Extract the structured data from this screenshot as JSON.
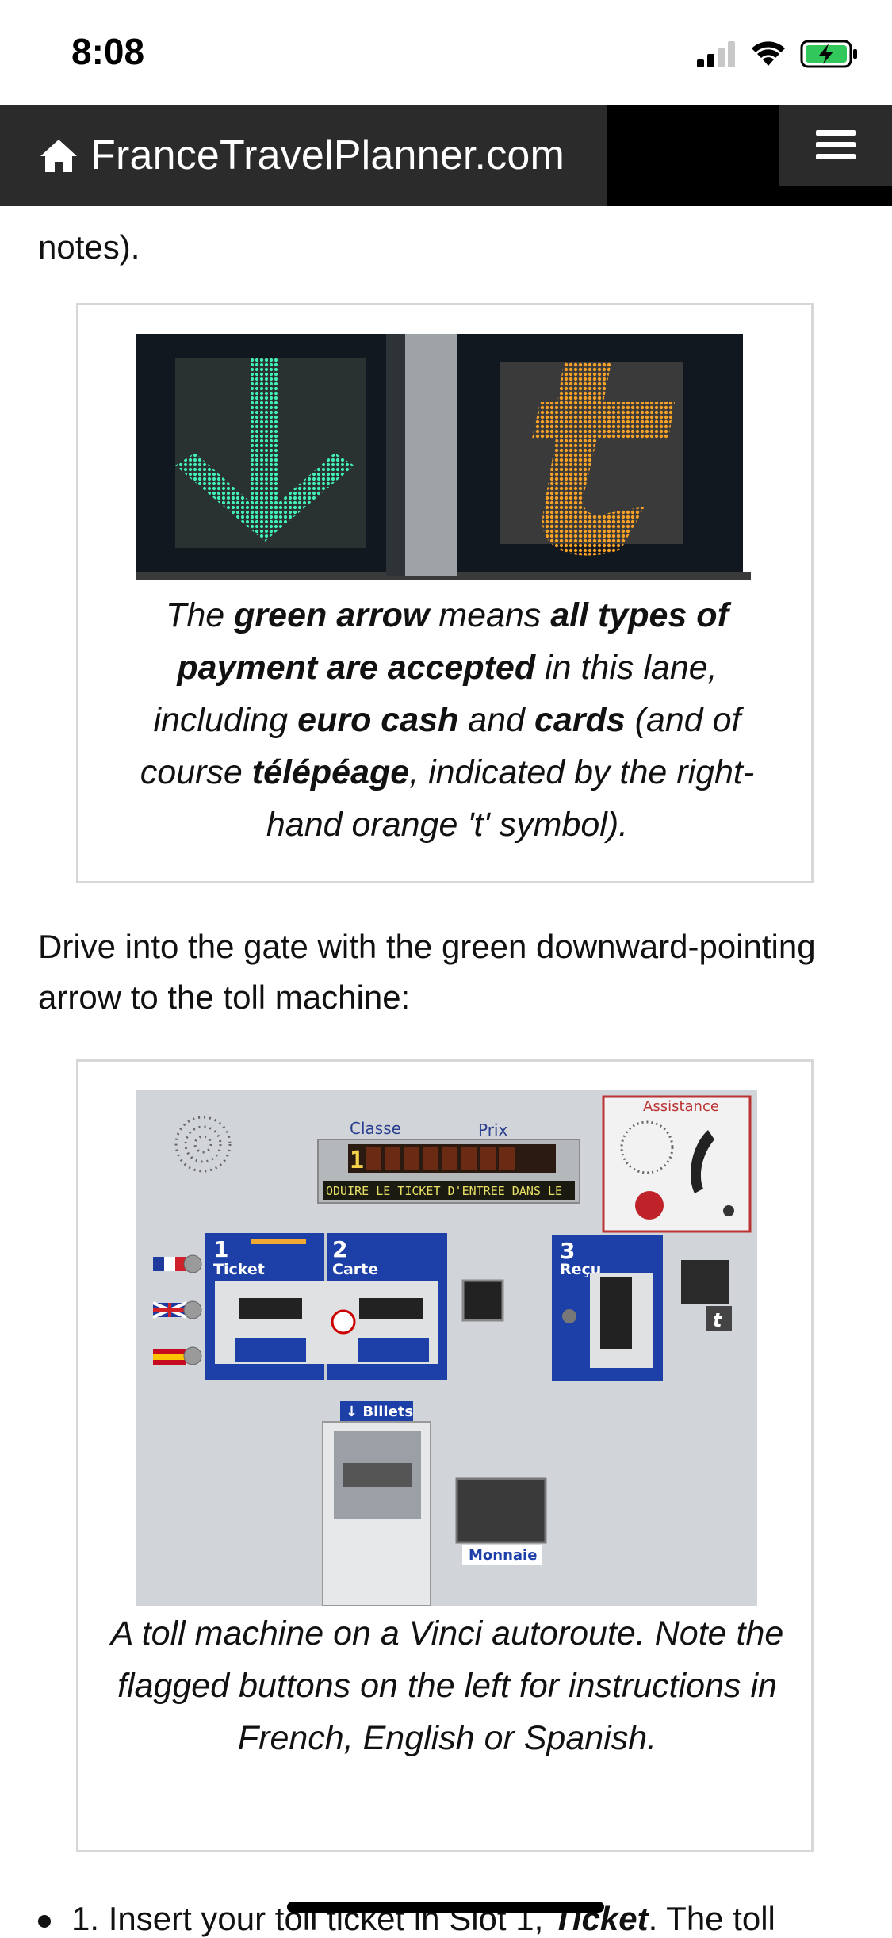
{
  "status_bar": {
    "time": "8:08"
  },
  "header": {
    "site_name": "FranceTravelPlanner.com"
  },
  "article": {
    "partial_line": "notes).",
    "figure1": {
      "caption_parts": [
        {
          "t": "The ",
          "b": false
        },
        {
          "t": "green arrow",
          "b": true
        },
        {
          "t": " means ",
          "b": false
        },
        {
          "t": "all types of payment are accepted",
          "b": true
        },
        {
          "t": " in this lane, including ",
          "b": false
        },
        {
          "t": "euro cash",
          "b": true
        },
        {
          "t": " and ",
          "b": false
        },
        {
          "t": "cards",
          "b": true
        },
        {
          "t": " (and of course ",
          "b": false
        },
        {
          "t": "télépéage",
          "b": true
        },
        {
          "t": ", indicated by the right-hand orange 't' symbol).",
          "b": false
        }
      ]
    },
    "paragraph2": "Drive into the gate with the green downward-pointing arrow to the toll machine:",
    "figure2": {
      "caption": "A toll machine on a Vinci autoroute. Note the flagged buttons on the left for instructions in French, English or Spanish.",
      "machine": {
        "assistance": "Assistance",
        "classe": "Classe",
        "prix": "Prix",
        "display_digit": "1",
        "ticker": "ODUIRE LE TICKET D'ENTREE DANS LE",
        "slot1_num": "1",
        "slot1_label": "Ticket",
        "slot2_num": "2",
        "slot2_label": "Carte",
        "slot3_num": "3",
        "slot3_label": "Reçu",
        "billets": "↓ Billets",
        "monnaie": "Monnaie",
        "t_symbol": "t"
      }
    },
    "bullet": {
      "prefix": "1. Insert your toll ticket in Slot 1, ",
      "emph": "Ticket",
      "suffix": ". The toll"
    }
  },
  "colors": {
    "header_bg": "#2b2b2b",
    "arrow_green": "#37e6b0",
    "t_orange": "#f39a1c",
    "machine_blue": "#1c3fa8"
  }
}
